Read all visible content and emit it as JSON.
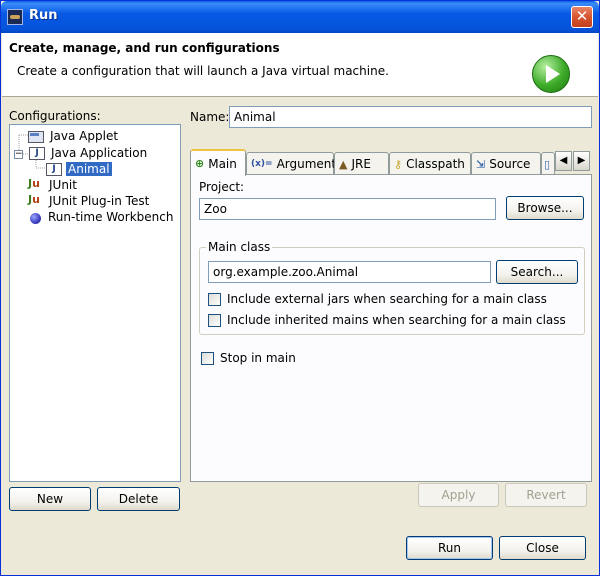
{
  "window": {
    "title": "Run"
  },
  "banner": {
    "title": "Create, manage, and run configurations",
    "description": "Create a configuration that will launch a Java virtual machine."
  },
  "configurations": {
    "label": "Configurations:",
    "tree": [
      {
        "label": "Java Applet",
        "icon": "java-applet-icon"
      },
      {
        "label": "Java Application",
        "icon": "java-application-icon",
        "expanded": true
      },
      {
        "label": "Animal",
        "icon": "java-class-icon",
        "selected": true
      },
      {
        "label": "JUnit",
        "icon": "junit-icon"
      },
      {
        "label": "JUnit Plug-in Test",
        "icon": "junit-plugin-icon"
      },
      {
        "label": "Run-time Workbench",
        "icon": "workbench-icon"
      }
    ],
    "new_label": "New",
    "delete_label": "Delete"
  },
  "name": {
    "label": "Name:",
    "value": "Animal"
  },
  "tabs": [
    {
      "label": "Main",
      "icon": "main-icon",
      "active": true
    },
    {
      "label": "Arguments",
      "icon": "arguments-icon"
    },
    {
      "label": "JRE",
      "icon": "jre-icon"
    },
    {
      "label": "Classpath",
      "icon": "classpath-icon"
    },
    {
      "label": "Source",
      "icon": "source-icon"
    }
  ],
  "main": {
    "project_label": "Project:",
    "project_value": "Zoo",
    "browse_label": "Browse...",
    "main_class_group": "Main class",
    "main_class_value": "org.example.zoo.Animal",
    "search_label": "Search...",
    "include_external": "Include external jars when searching for a main class",
    "include_inherited": "Include inherited mains when searching for a main class",
    "stop_in_main": "Stop in main"
  },
  "actions": {
    "apply": "Apply",
    "revert": "Revert",
    "run": "Run",
    "close": "Close"
  },
  "colors": {
    "title_bar": "#0a5fe7",
    "selection": "#316ac5",
    "dialog_bg": "#ece9d8",
    "run_green": "#3caa28"
  }
}
